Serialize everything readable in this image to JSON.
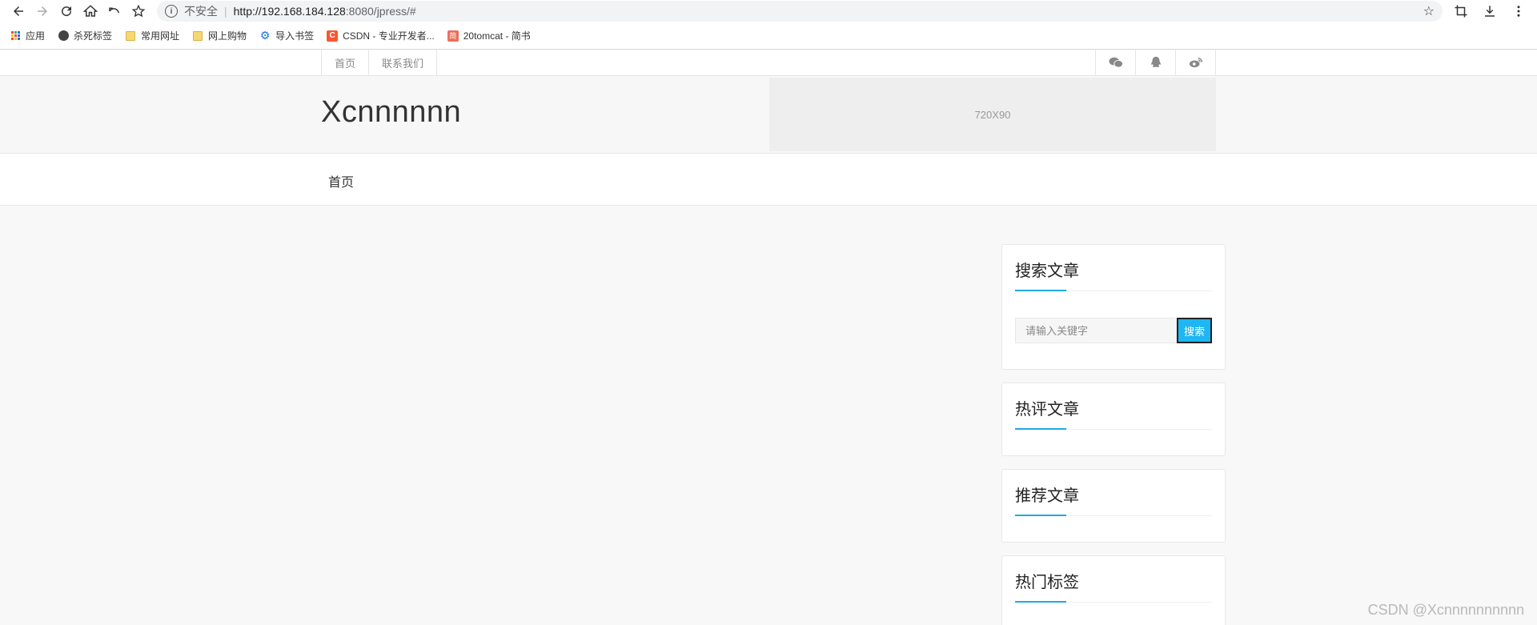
{
  "browser": {
    "address": {
      "insecure_label": "不安全",
      "separator": "|",
      "url_host": "http://192.168.184.128",
      "url_rest": ":8080/jpress/#"
    },
    "bookmarks": [
      {
        "label": "应用",
        "icon": "apps-icon"
      },
      {
        "label": "杀死标签",
        "icon": "globe-icon"
      },
      {
        "label": "常用网址",
        "icon": "folder-icon"
      },
      {
        "label": "网上购物",
        "icon": "folder-icon"
      },
      {
        "label": "导入书签",
        "icon": "gear-icon"
      },
      {
        "label": "CSDN - 专业开发者...",
        "icon": "csdn-icon"
      },
      {
        "label": "20tomcat - 简书",
        "icon": "jianshu-icon"
      }
    ],
    "csdn_glyph": "C",
    "jianshu_glyph": "简"
  },
  "site": {
    "topnav": [
      "首页",
      "联系我们"
    ],
    "social": [
      "wechat-icon",
      "qq-icon",
      "weibo-icon"
    ],
    "title": "Xcnnnnnn",
    "ad_text": "720X90",
    "mainnav": [
      "首页"
    ]
  },
  "sidebar": {
    "search": {
      "title": "搜索文章",
      "placeholder": "请输入关键字",
      "button": "搜索"
    },
    "hot_comments_title": "热评文章",
    "recommended_title": "推荐文章",
    "hot_tags_title": "热门标签"
  },
  "watermark": "CSDN @Xcnnnnnnnnnn",
  "colors": {
    "accent": "#1fa9e1",
    "search_button": "#1fb6f4"
  }
}
